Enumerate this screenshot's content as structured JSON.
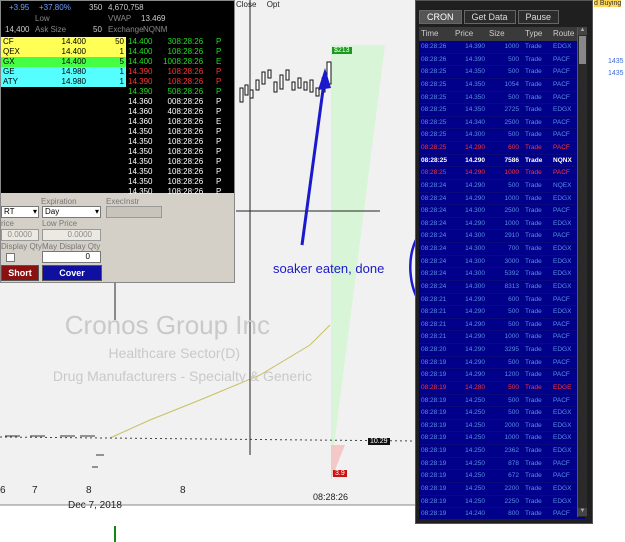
{
  "chart": {
    "company": "Cronos Group Inc",
    "sector": "Healthcare Sector(D)",
    "industry": "Drug Manufacturers - Specialty & Generic",
    "price_box_top": "$213",
    "price_box_mid": "10.29",
    "price_box_bottom": "3.9",
    "x_labels": [
      "6",
      "7",
      "8",
      "8"
    ],
    "date_label": "Dec 7, 2018",
    "time_label": "08:28:26",
    "annotation": "soaker eaten, done",
    "right_labels": [
      "d Buying",
      "1435",
      "1435"
    ]
  },
  "menu": {
    "items": [
      "Close",
      "Opt"
    ]
  },
  "quote": {
    "change": "+3.95",
    "change_pct": "+37.80%",
    "col3": "350",
    "volume": "4,670,758",
    "label1": "Low",
    "label2": "VWAP",
    "vwap": "13.469",
    "bid_price": "14,400",
    "bid_label": "Ask Size",
    "ask_size": "50",
    "exch_label": "Exchange",
    "exch": "NQNM"
  },
  "levels": [
    {
      "ex": "CF",
      "price": "14.400",
      "size": "50",
      "bg": "#ffff55"
    },
    {
      "ex": "QEX",
      "price": "14.400",
      "size": "1",
      "bg": "#ffff55"
    },
    {
      "ex": "GX",
      "price": "14.400",
      "size": "5",
      "bg": "#44ff44"
    },
    {
      "ex": "GE",
      "price": "14.980",
      "size": "1",
      "bg": "#55ffff"
    },
    {
      "ex": "ATY",
      "price": "14.980",
      "size": "1",
      "bg": "#55ffff"
    }
  ],
  "prints": [
    {
      "price": "14.400",
      "size": "3",
      "time": "08:28:26",
      "ex": "P",
      "color": "#22dd22"
    },
    {
      "price": "14.400",
      "size": "1",
      "time": "08:28:26",
      "ex": "P",
      "color": "#22dd22"
    },
    {
      "price": "14.400",
      "size": "10",
      "time": "08:28:26",
      "ex": "E",
      "color": "#22dd22"
    },
    {
      "price": "14.390",
      "size": "1",
      "time": "08:28:26",
      "ex": "P",
      "color": "#ff3333"
    },
    {
      "price": "14.390",
      "size": "1",
      "time": "08:28:26",
      "ex": "P",
      "color": "#ff3333"
    },
    {
      "price": "14.390",
      "size": "5",
      "time": "08:28:26",
      "ex": "P",
      "color": "#22dd22"
    },
    {
      "price": "14.360",
      "size": "0",
      "time": "08:28:26",
      "ex": "P",
      "color": "#ffffff"
    },
    {
      "price": "14.360",
      "size": "4",
      "time": "08:28:26",
      "ex": "P",
      "color": "#ffffff"
    },
    {
      "price": "14.360",
      "size": "1",
      "time": "08:28:26",
      "ex": "E",
      "color": "#ffffff"
    },
    {
      "price": "14.350",
      "size": "1",
      "time": "08:28:26",
      "ex": "P",
      "color": "#ffffff"
    },
    {
      "price": "14.350",
      "size": "1",
      "time": "08:28:26",
      "ex": "P",
      "color": "#ffffff"
    },
    {
      "price": "14.350",
      "size": "1",
      "time": "08:28:26",
      "ex": "P",
      "color": "#ffffff"
    },
    {
      "price": "14.350",
      "size": "1",
      "time": "08:28:26",
      "ex": "P",
      "color": "#ffffff"
    },
    {
      "price": "14.350",
      "size": "1",
      "time": "08:28:26",
      "ex": "P",
      "color": "#ffffff"
    },
    {
      "price": "14.350",
      "size": "1",
      "time": "08:28:26",
      "ex": "P",
      "color": "#ffffff"
    },
    {
      "price": "14.350",
      "size": "1",
      "time": "08:28:26",
      "ex": "P",
      "color": "#ffffff"
    }
  ],
  "order": {
    "type": "RT",
    "expiration_label": "Expiration",
    "expiration": "Day",
    "execinstr_label": "ExecInstr",
    "price_label": "rice",
    "limit_price_label": "Low Price",
    "price_val": "0.0000",
    "limit_val": "0.0000",
    "display_qty_label": "Display Qty",
    "max_display_label": "May Display Qty",
    "max_display_val": "0",
    "short_label": "Short",
    "cover_label": "Cover"
  },
  "ts": {
    "tabs": [
      "CRON",
      "Get Data",
      "Pause"
    ],
    "headers": [
      "Time",
      "Price",
      "Size",
      "Type",
      "Route"
    ],
    "rows": [
      [
        "08:28:26",
        "14.390",
        "1000",
        "Trade",
        "EDGX",
        "n"
      ],
      [
        "08:28:26",
        "14.390",
        "500",
        "Trade",
        "PACF",
        "n"
      ],
      [
        "08:28:25",
        "14.350",
        "500",
        "Trade",
        "PACF",
        "n"
      ],
      [
        "08:28:25",
        "14.350",
        "1054",
        "Trade",
        "PACF",
        "n"
      ],
      [
        "08:28:25",
        "14.350",
        "500",
        "Trade",
        "PACF",
        "n"
      ],
      [
        "08:28:25",
        "14.350",
        "2725",
        "Trade",
        "EDGX",
        "n"
      ],
      [
        "08:28:25",
        "14.340",
        "2500",
        "Trade",
        "PACF",
        "n"
      ],
      [
        "08:28:25",
        "14.300",
        "500",
        "Trade",
        "PACF",
        "n"
      ],
      [
        "08:28:25",
        "14.290",
        "600",
        "Trade",
        "PACF",
        "r"
      ],
      [
        "08:28:25",
        "14.290",
        "7586",
        "Trade",
        "NQNX",
        "w"
      ],
      [
        "08:28:25",
        "14.290",
        "1000",
        "Trade",
        "PACF",
        "r"
      ],
      [
        "08:28:24",
        "14.290",
        "500",
        "Trade",
        "NQEX",
        "n"
      ],
      [
        "08:28:24",
        "14.290",
        "1000",
        "Trade",
        "EDGX",
        "n"
      ],
      [
        "08:28:24",
        "14.300",
        "2500",
        "Trade",
        "PACF",
        "n"
      ],
      [
        "08:28:24",
        "14.290",
        "1000",
        "Trade",
        "EDGX",
        "n"
      ],
      [
        "08:28:24",
        "14.300",
        "2910",
        "Trade",
        "PACF",
        "n"
      ],
      [
        "08:28:24",
        "14.300",
        "700",
        "Trade",
        "EDGX",
        "n"
      ],
      [
        "08:28:24",
        "14.300",
        "3000",
        "Trade",
        "EDGX",
        "n"
      ],
      [
        "08:28:24",
        "14.300",
        "5392",
        "Trade",
        "EDGX",
        "n"
      ],
      [
        "08:28:24",
        "14.300",
        "8313",
        "Trade",
        "EDGX",
        "n"
      ],
      [
        "08:28:21",
        "14.290",
        "600",
        "Trade",
        "PACF",
        "n"
      ],
      [
        "08:28:21",
        "14.290",
        "500",
        "Trade",
        "EDGX",
        "n"
      ],
      [
        "08:28:21",
        "14.290",
        "500",
        "Trade",
        "PACF",
        "n"
      ],
      [
        "08:28:21",
        "14.290",
        "1000",
        "Trade",
        "PACF",
        "n"
      ],
      [
        "08:28:20",
        "14.290",
        "3295",
        "Trade",
        "EDGX",
        "n"
      ],
      [
        "08:28:19",
        "14.290",
        "500",
        "Trade",
        "PACF",
        "n"
      ],
      [
        "08:28:19",
        "14.290",
        "1200",
        "Trade",
        "PACF",
        "n"
      ],
      [
        "08:28:19",
        "14.280",
        "500",
        "Trade",
        "EDGE",
        "r"
      ],
      [
        "08:28:19",
        "14.250",
        "500",
        "Trade",
        "PACF",
        "n"
      ],
      [
        "08:28:19",
        "14.250",
        "500",
        "Trade",
        "EDGX",
        "n"
      ],
      [
        "08:28:19",
        "14.250",
        "2000",
        "Trade",
        "EDGX",
        "n"
      ],
      [
        "08:28:19",
        "14.250",
        "1000",
        "Trade",
        "EDGX",
        "n"
      ],
      [
        "08:28:19",
        "14.250",
        "2362",
        "Trade",
        "EDGX",
        "n"
      ],
      [
        "08:28:19",
        "14.250",
        "878",
        "Trade",
        "PACF",
        "n"
      ],
      [
        "08:28:19",
        "14.250",
        "672",
        "Trade",
        "PACF",
        "n"
      ],
      [
        "08:28:19",
        "14.250",
        "2200",
        "Trade",
        "EDGX",
        "n"
      ],
      [
        "08:28:19",
        "14.250",
        "2250",
        "Trade",
        "EDGX",
        "n"
      ],
      [
        "08:28:19",
        "14.240",
        "800",
        "Trade",
        "PACF",
        "n"
      ]
    ]
  },
  "colors": {
    "trade_text": "#5b8fe0",
    "red_text": "#ff3333",
    "white_text": "#ffffff",
    "ts_bg": "#00008b",
    "annotation": "#1a1acc"
  }
}
